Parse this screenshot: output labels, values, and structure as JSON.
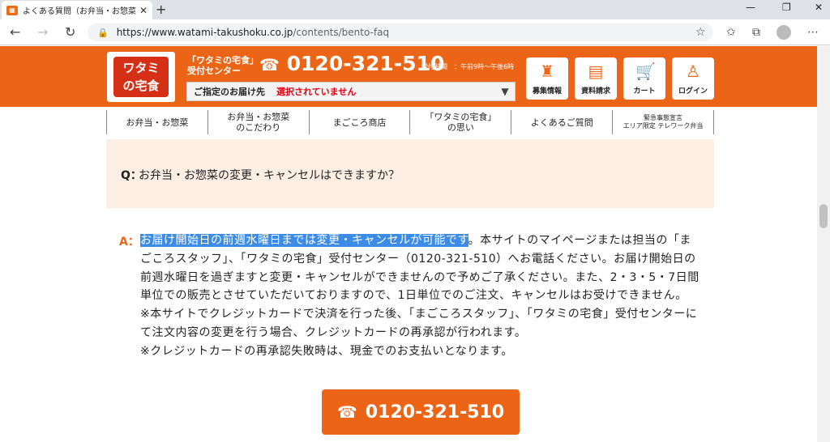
{
  "browser": {
    "tab_title": "よくある質問（お弁当・お惣菜）| ワ",
    "url_host": "https://www.watami-takushoku.co.jp",
    "url_path": "/contents/bento-faq"
  },
  "header": {
    "logo_line1": "ワタミ",
    "logo_line2": "の宅食",
    "center_line1": "「ワタミの宅食」",
    "center_line2": "受付センター",
    "phone": "0120-321-510",
    "hours": "受付時間　：午前9時～午後6時",
    "delivery_label": "ご指定のお届け先",
    "delivery_value": "選択されていません",
    "buttons": [
      {
        "label": "募集情報",
        "icon": "person-apron-icon"
      },
      {
        "label": "資料請求",
        "icon": "document-icon"
      },
      {
        "label": "カート",
        "icon": "cart-icon"
      },
      {
        "label": "ログイン",
        "icon": "person-icon"
      }
    ]
  },
  "nav": [
    {
      "line1": "お弁当・お惣菜",
      "line2": ""
    },
    {
      "line1": "お弁当・お惣菜",
      "line2": "のこだわり"
    },
    {
      "line1": "まごころ商店",
      "line2": ""
    },
    {
      "line1": "「ワタミの宅食」",
      "line2": "の思い"
    },
    {
      "line1": "よくあるご質問",
      "line2": ""
    },
    {
      "line1": "緊急事態宣言",
      "line2": "エリア限定 テレワーク弁当"
    }
  ],
  "faq": {
    "q_mark": "Q：",
    "question": "お弁当・お惣菜の変更・キャンセルはできますか？",
    "a_mark": "A：",
    "answer_highlight": "お届け開始日の前週水曜日までは変更・キャンセルが可能です",
    "answer_rest": "。本サイトのマイページまたは担当の「まごころスタッフ」、「ワタミの宅食」受付センター（0120-321-510）へお電話ください。お届け開始日の前週水曜日を過ぎますと変更・キャンセルができませんので予めご了承ください。また、2・3・5・7日間単位での販売とさせていただいておりますので、1日単位でのご注文、キャンセルはお受けできません。",
    "note1": "※本サイトでクレジットカードで決済を行った後、「まごころスタッフ」、「ワタミの宅食」受付センターにて注文内容の変更を行う場合、クレジットカードの再承認が行われます。",
    "note2": "※クレジットカードの再承認失敗時は、現金でのお支払いとなります。",
    "cta_phone": "0120-321-510"
  }
}
